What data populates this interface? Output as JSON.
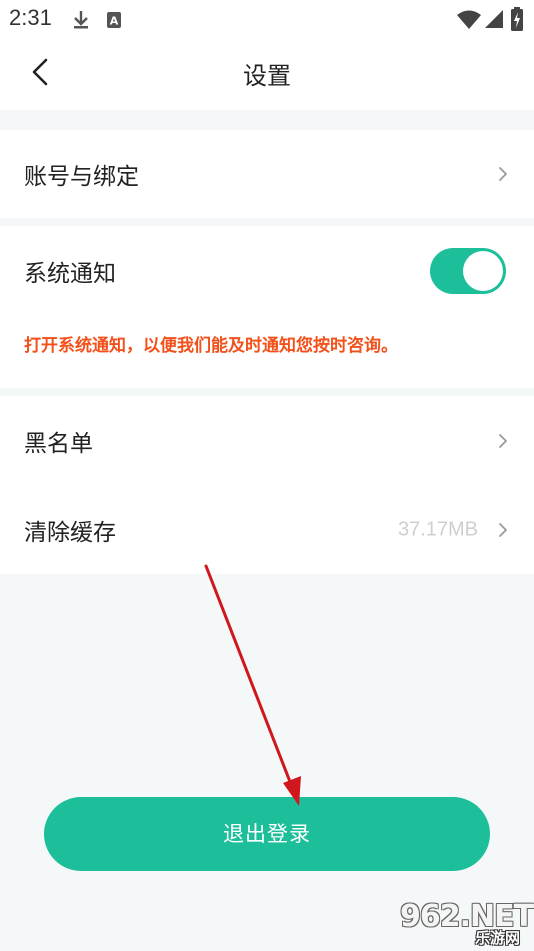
{
  "status_bar": {
    "time": "2:31",
    "icons": [
      "download-icon",
      "keyboard-a-icon",
      "wifi-icon",
      "signal-icon",
      "battery-icon"
    ]
  },
  "header": {
    "title": "设置",
    "back_icon": "chevron-left-icon"
  },
  "settings": {
    "account_binding": "账号与绑定",
    "system_notification": {
      "label": "系统通知",
      "enabled": true,
      "notice": "打开系统通知，以便我们能及时通知您按时咨询。"
    },
    "blacklist": "黑名单",
    "clear_cache": {
      "label": "清除缓存",
      "size": "37.17MB"
    }
  },
  "logout_button": "退出登录",
  "watermark": {
    "brand": "962.NET",
    "sub": "乐游网"
  },
  "colors": {
    "accent": "#1dbf9b",
    "notice": "#f2511b",
    "annotation_arrow": "#d0171d"
  }
}
